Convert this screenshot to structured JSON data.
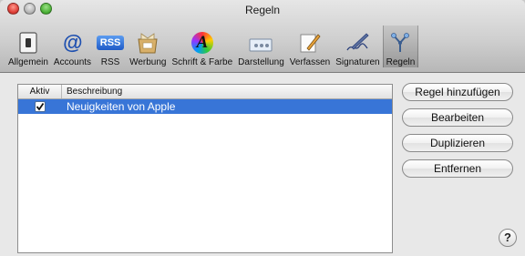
{
  "window": {
    "title": "Regeln"
  },
  "toolbar": {
    "items": [
      {
        "label": "Allgemein",
        "icon": "switch-icon"
      },
      {
        "label": "Accounts",
        "icon": "at-sign-icon",
        "glyph": "@"
      },
      {
        "label": "RSS",
        "icon": "rss-icon",
        "glyph": "RSS"
      },
      {
        "label": "Werbung",
        "icon": "junk-mail-icon"
      },
      {
        "label": "Schrift & Farbe",
        "icon": "font-color-icon",
        "glyph": "A"
      },
      {
        "label": "Darstellung",
        "icon": "display-icon"
      },
      {
        "label": "Verfassen",
        "icon": "compose-pencil-icon"
      },
      {
        "label": "Signaturen",
        "icon": "signature-pen-icon"
      },
      {
        "label": "Regeln",
        "icon": "rules-icon"
      }
    ],
    "selected": "Regeln"
  },
  "rules_table": {
    "columns": {
      "aktiv": "Aktiv",
      "beschreibung": "Beschreibung"
    },
    "rows": [
      {
        "active": true,
        "description": "Neuigkeiten von Apple"
      }
    ]
  },
  "actions": {
    "add": "Regel hinzufügen",
    "edit": "Bearbeiten",
    "duplicate": "Duplizieren",
    "remove": "Entfernen"
  },
  "help": {
    "glyph": "?"
  },
  "colors": {
    "selection": "#3875d7"
  }
}
